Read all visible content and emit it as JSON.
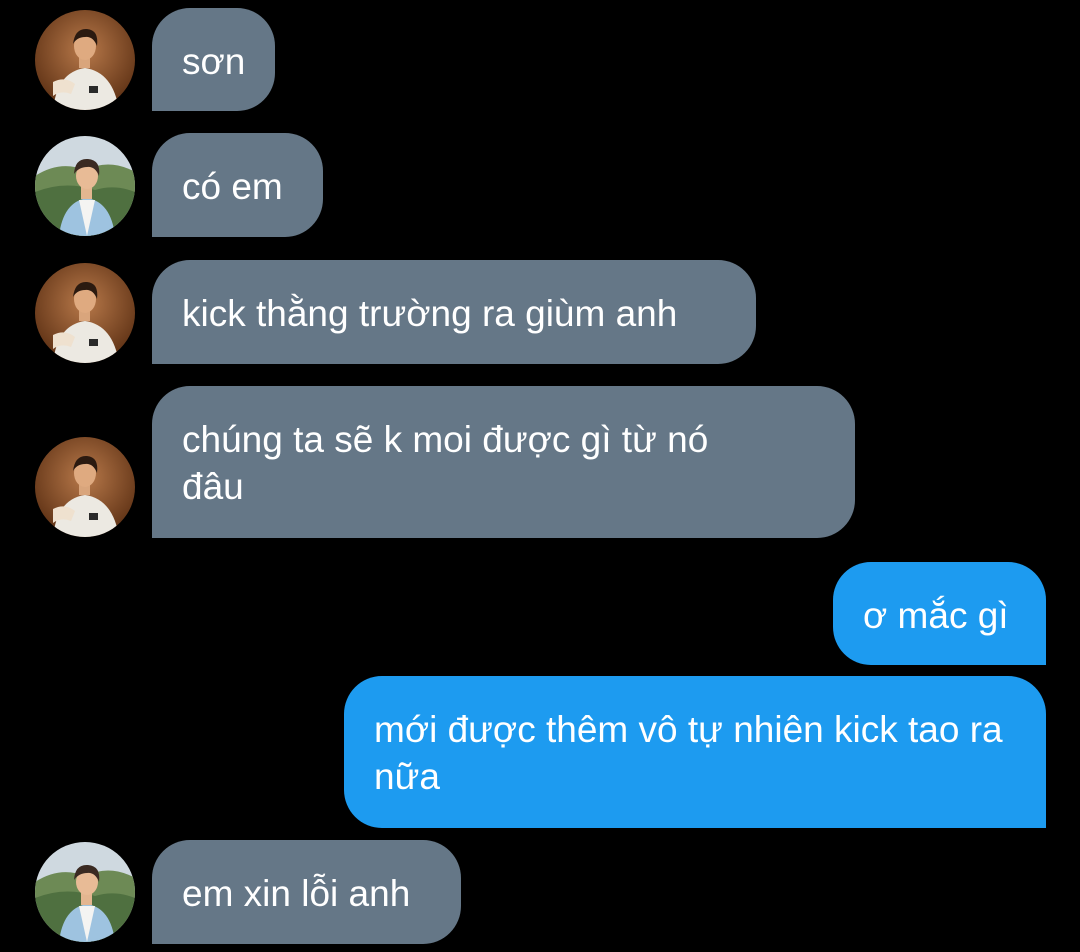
{
  "conversation": {
    "messages": [
      {
        "direction": "incoming",
        "sender": "avatar-a",
        "text": "sơn"
      },
      {
        "direction": "incoming",
        "sender": "avatar-b",
        "text": "có em"
      },
      {
        "direction": "incoming",
        "sender": "avatar-a",
        "text": "kick thằng trường ra giùm anh"
      },
      {
        "direction": "incoming",
        "sender": "avatar-a",
        "text": "chúng ta sẽ k moi được gì từ nó đâu"
      },
      {
        "direction": "outgoing",
        "text": "ơ mắc gì"
      },
      {
        "direction": "outgoing",
        "text": "mới được thêm vô tự nhiên kick tao ra nữa"
      },
      {
        "direction": "incoming",
        "sender": "avatar-b",
        "text": "em xin lỗi anh"
      }
    ]
  },
  "colors": {
    "background": "#000000",
    "incoming_bubble": "#657787",
    "outgoing_bubble": "#1d9bf0",
    "text": "#ffffff"
  }
}
